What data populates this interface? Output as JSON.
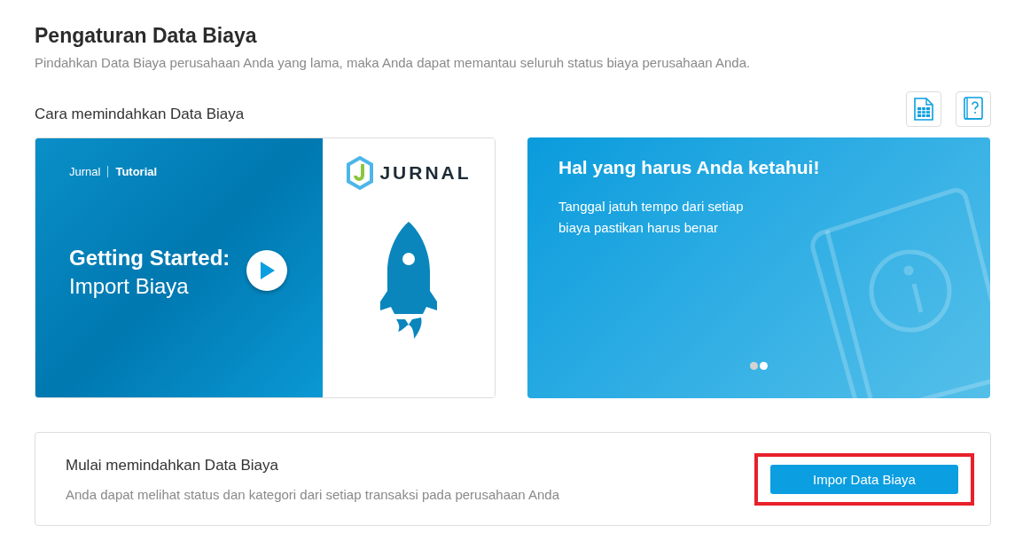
{
  "header": {
    "title": "Pengaturan Data Biaya",
    "subtitle": "Pindahkan Data Biaya perusahaan Anda yang lama, maka Anda dapat memantau seluruh status biaya perusahaan Anda."
  },
  "section": {
    "title": "Cara memindahkan Data Biaya"
  },
  "video": {
    "brand": "Jurnal",
    "tag": "Tutorial",
    "title": "Getting Started:",
    "subtitle": "Import Biaya",
    "logo_text": "JURNAL"
  },
  "tips": {
    "title": "Hal yang harus Anda ketahui!",
    "text": "Tanggal jatuh tempo dari setiap biaya pastikan harus benar",
    "dots": [
      {
        "selected": false
      },
      {
        "selected": true
      }
    ]
  },
  "import": {
    "title": "Mulai memindahkan Data Biaya",
    "text": "Anda dapat melihat status dan kategori dari setiap transaksi pada perusahaan Anda",
    "button": "Impor Data Biaya",
    "highlighted": true
  }
}
